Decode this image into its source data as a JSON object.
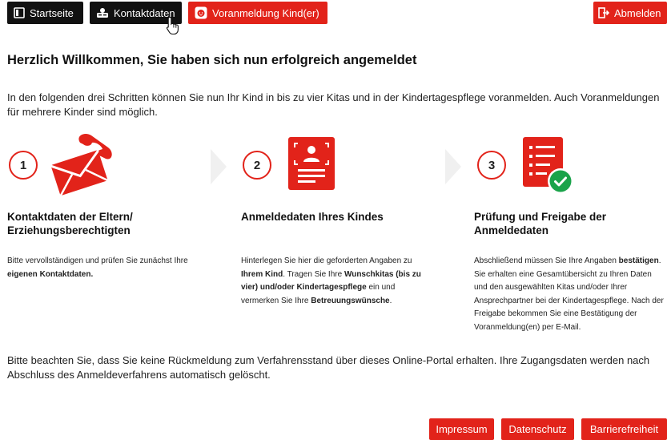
{
  "nav": {
    "startseite": "Startseite",
    "kontaktdaten": "Kontaktdaten",
    "voranmeldung": "Voranmeldung Kind(er)",
    "abmelden": "Abmelden"
  },
  "welcome": {
    "title": "Herzlich Willkommen, Sie haben sich nun erfolgreich angemeldet",
    "intro": "In den folgenden drei Schritten können Sie nun Ihr Kind in bis zu vier Kitas und in der Kindertagespflege voranmelden. Auch Voranmeldungen für mehrere Kinder sind möglich."
  },
  "steps": [
    {
      "number": "1",
      "title": "Kontaktdaten der Eltern/ Erziehungsberechtigten",
      "text_1": "Bitte vervollständigen und prüfen Sie zunächst Ihre",
      "text_2": "eigenen Kontaktdaten."
    },
    {
      "number": "2",
      "title": "Anmeldedaten Ihres Kindes",
      "text_1": "Hinterlegen Sie hier die geforderten Angaben zu",
      "text_2": "Ihrem Kind",
      "text_3": ". Tragen Sie Ihre ",
      "text_4": "Wunschkitas (bis zu vier) und/oder Kindertagespflege",
      "text_5": " ein und vermerken Sie Ihre ",
      "text_6": "Betreuungswünsche",
      "text_7": "."
    },
    {
      "number": "3",
      "title": "Prüfung und Freigabe der Anmeldedaten",
      "text_1": "Abschließend müssen Sie Ihre Angaben ",
      "text_2": "bestätigen",
      "text_3": ". Sie erhalten eine Gesamtübersicht zu Ihren Daten und den ausgewählten Kitas und/oder Ihrer Ansprechpartner bei der Kindertagespflege. Nach der Freigabe bekommen Sie eine Bestätigung der Voranmeldung(en) per E-Mail."
    }
  ],
  "notice": "Bitte beachten Sie, dass Sie keine Rückmeldung zum Verfahrensstand über dieses Online-Portal erhalten. Ihre Zugangsdaten werden nach Abschluss des Anmeldeverfahrens automatisch gelöscht.",
  "footer": {
    "impressum": "Impressum",
    "datenschutz": "Datenschutz",
    "barrierefreiheit": "Barrierefreiheit"
  },
  "colors": {
    "accent": "#e2231a",
    "dark_button": "#111111",
    "check_green": "#1aa34a"
  }
}
